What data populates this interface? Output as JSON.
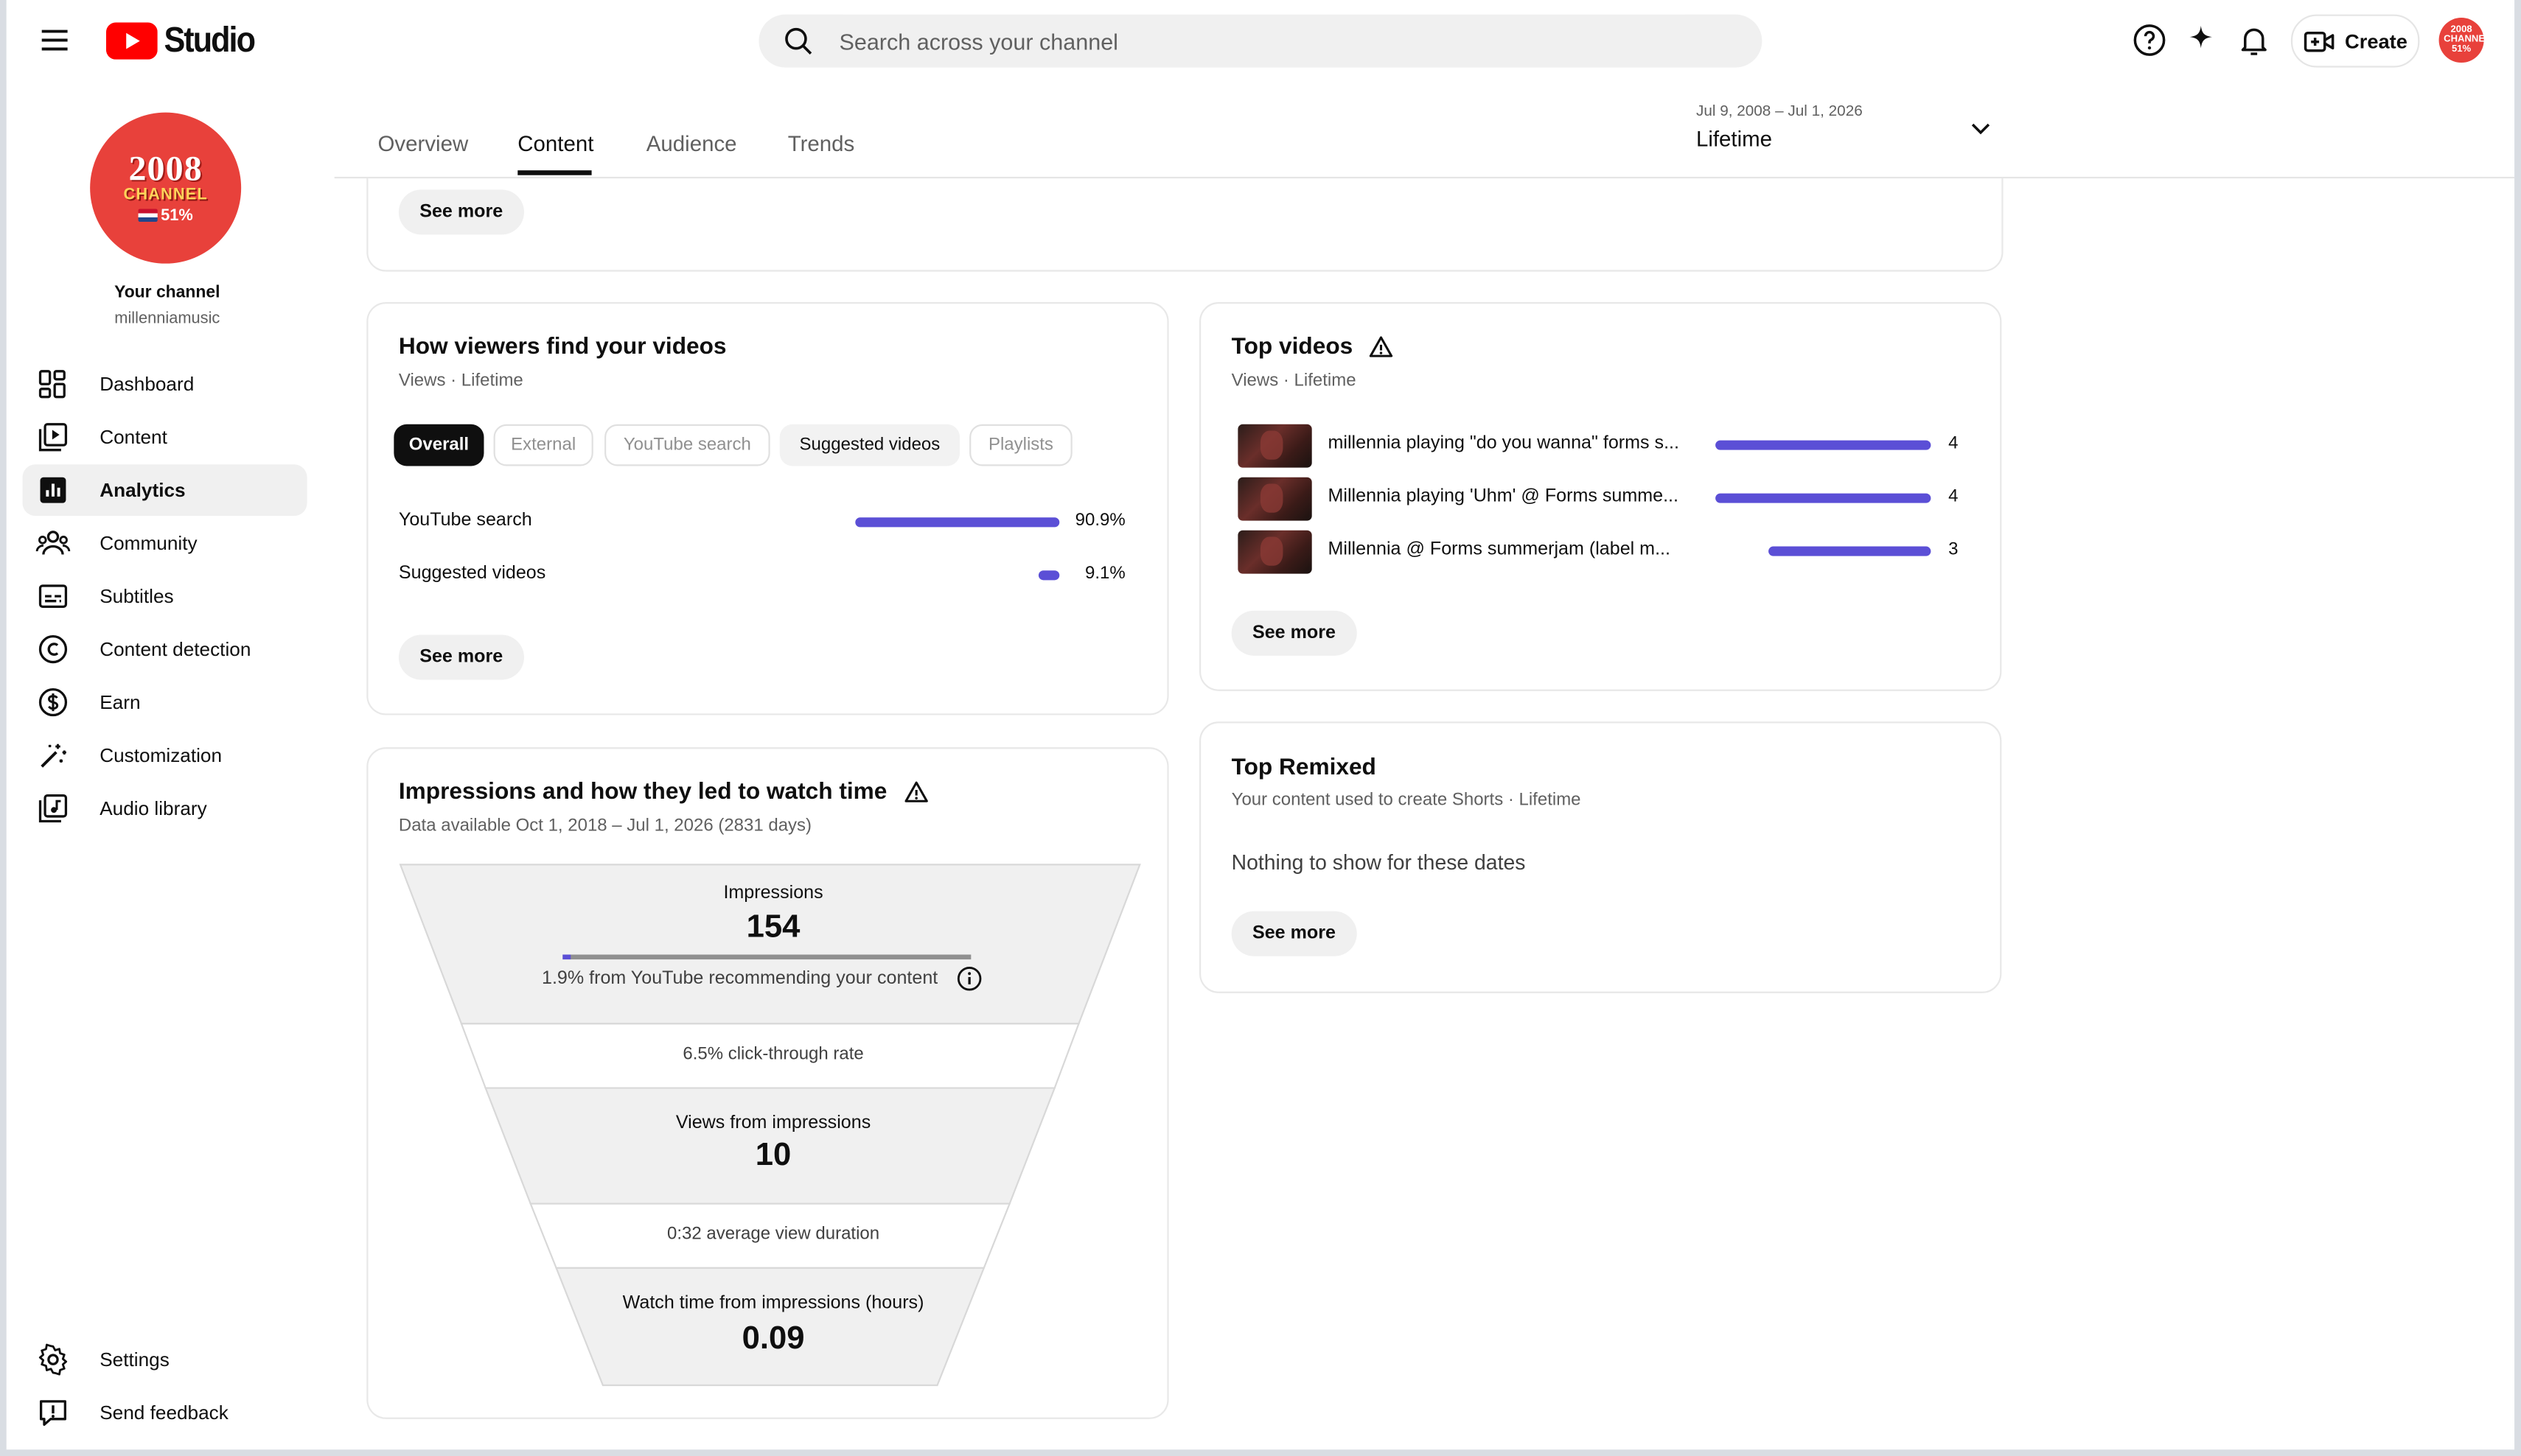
{
  "header": {
    "logo_text": "Studio",
    "search_placeholder": "Search across your channel",
    "create_label": "Create",
    "avatar_text": "2008 CHANNEL 51%"
  },
  "sidebar": {
    "avatar": {
      "year": "2008",
      "line2": "CHANNEL",
      "line3": "51%"
    },
    "channel_label": "Your channel",
    "handle": "millenniamusic",
    "items": [
      {
        "label": "Dashboard",
        "icon": "dashboard-icon"
      },
      {
        "label": "Content",
        "icon": "content-icon"
      },
      {
        "label": "Analytics",
        "icon": "analytics-icon",
        "active": true
      },
      {
        "label": "Community",
        "icon": "community-icon"
      },
      {
        "label": "Subtitles",
        "icon": "subtitles-icon"
      },
      {
        "label": "Content detection",
        "icon": "copyright-icon"
      },
      {
        "label": "Earn",
        "icon": "dollar-icon"
      },
      {
        "label": "Customization",
        "icon": "magic-wand-icon"
      },
      {
        "label": "Audio library",
        "icon": "audio-library-icon"
      }
    ],
    "bottom_items": [
      {
        "label": "Settings",
        "icon": "gear-icon"
      },
      {
        "label": "Send feedback",
        "icon": "feedback-icon"
      }
    ]
  },
  "tabs": [
    "Overview",
    "Content",
    "Audience",
    "Trends"
  ],
  "active_tab": "Content",
  "date_selector": {
    "range": "Jul 9, 2008 – Jul 1, 2026",
    "label": "Lifetime"
  },
  "top_card": {
    "see_more": "See more"
  },
  "traffic_card": {
    "title": "How viewers find your videos",
    "subtitle": "Views · Lifetime",
    "chips": [
      "Overall",
      "External",
      "YouTube search",
      "Suggested videos",
      "Playlists"
    ],
    "rows": [
      {
        "label": "YouTube search",
        "percent": 90.9,
        "value": "90.9%"
      },
      {
        "label": "Suggested videos",
        "percent": 9.1,
        "value": "9.1%"
      }
    ],
    "see_more": "See more"
  },
  "top_videos_card": {
    "title": "Top videos",
    "subtitle": "Views · Lifetime",
    "rows": [
      {
        "title": "millennia playing \"do you wanna\" forms s...",
        "views": 4
      },
      {
        "title": "Millennia playing 'Uhm' @ Forms summe...",
        "views": 4
      },
      {
        "title": "Millennia @ Forms summerjam (label m...",
        "views": 3
      }
    ],
    "see_more": "See more"
  },
  "top_remixed_card": {
    "title": "Top Remixed",
    "subtitle": "Your content used to create Shorts · Lifetime",
    "empty_text": "Nothing to show for these dates",
    "see_more": "See more"
  },
  "impressions_card": {
    "title": "Impressions and how they led to watch time",
    "subtitle": "Data available Oct 1, 2018 – Jul 1, 2026 (2831 days)",
    "impressions_label": "Impressions",
    "impressions_value": "154",
    "recommend_fraction": 0.019,
    "recommend_text": "1.9% from YouTube recommending your content",
    "ctr_text": "6.5% click-through rate",
    "views_label": "Views from impressions",
    "views_value": "10",
    "avd_text": "0:32 average view duration",
    "watch_label": "Watch time from impressions (hours)",
    "watch_value": "0.09"
  },
  "colors": {
    "accent_bar": "#5b4fd6",
    "brand_red": "#ff0000",
    "avatar_red": "#e8413b"
  }
}
